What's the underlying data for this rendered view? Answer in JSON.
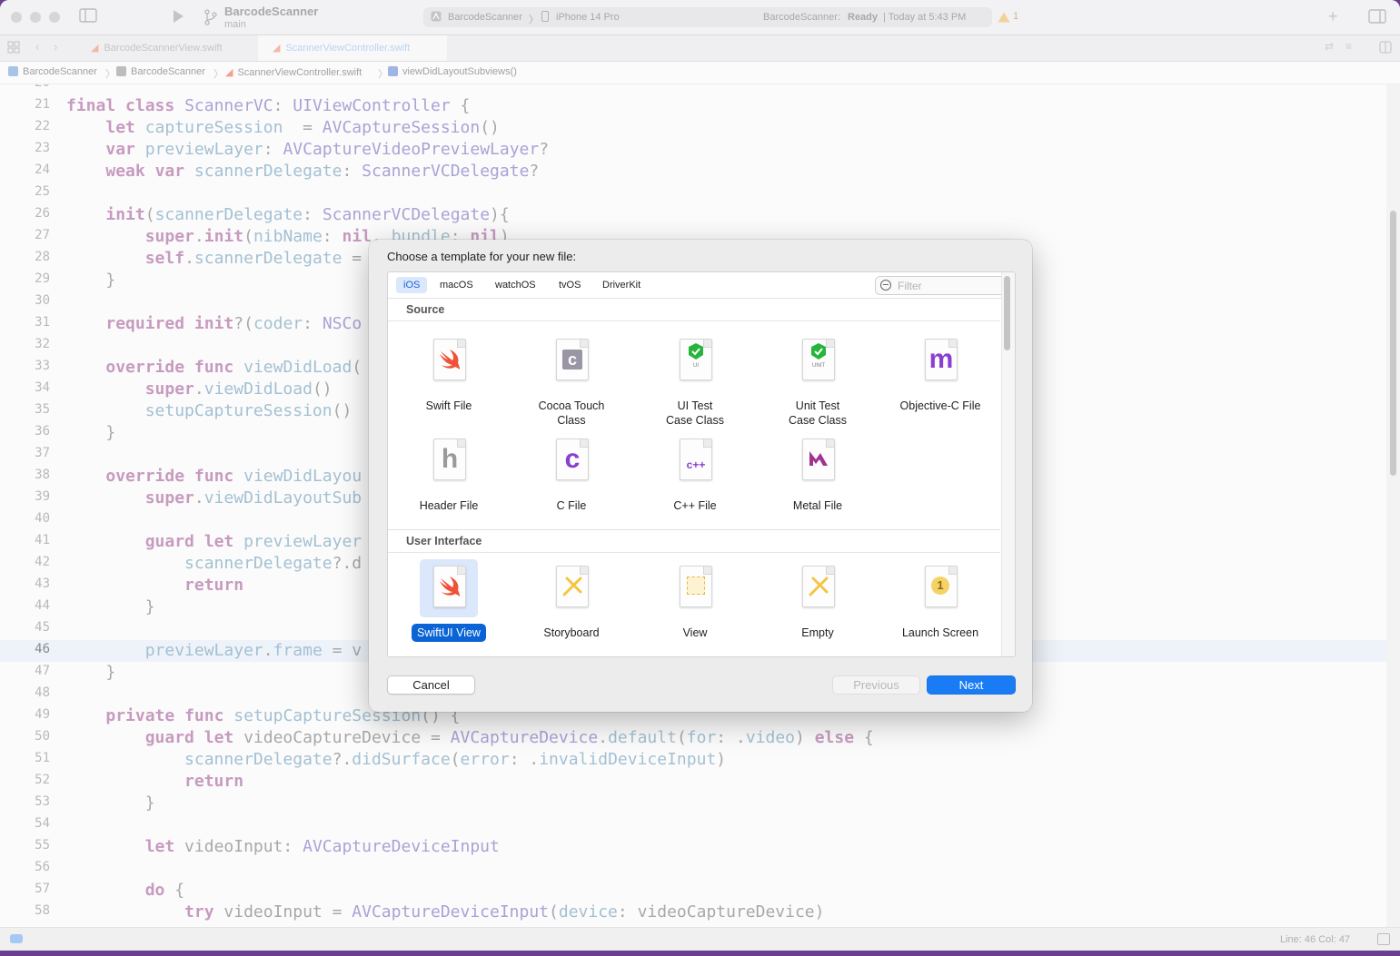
{
  "toolbar": {
    "project_name": "BarcodeScanner",
    "branch": "main",
    "scheme": "BarcodeScanner",
    "device": "iPhone 14 Pro",
    "status_project": "BarcodeScanner:",
    "status_state": "Ready",
    "status_time": "| Today at 5:43 PM",
    "warning_count": "1"
  },
  "tabs": [
    {
      "label": "BarcodeScannerView.swift"
    },
    {
      "label": "ScannerViewController.swift"
    }
  ],
  "breadcrumb": {
    "items": [
      "BarcodeScanner",
      "BarcodeScanner",
      "ScannerViewController.swift",
      "viewDidLayoutSubviews()"
    ]
  },
  "editor": {
    "current_line": "46",
    "lines": [
      {
        "n": "20",
        "t": ""
      },
      {
        "n": "21",
        "t": "final class ScannerVC: UIViewController {"
      },
      {
        "n": "22",
        "t": "    let captureSession  = AVCaptureSession()"
      },
      {
        "n": "23",
        "t": "    var previewLayer: AVCaptureVideoPreviewLayer?"
      },
      {
        "n": "24",
        "t": "    weak var scannerDelegate: ScannerVCDelegate?"
      },
      {
        "n": "25",
        "t": ""
      },
      {
        "n": "26",
        "t": "    init(scannerDelegate: ScannerVCDelegate){"
      },
      {
        "n": "27",
        "t": "        super.init(nibName: nil, bundle: nil)"
      },
      {
        "n": "28",
        "t": "        self.scannerDelegate ="
      },
      {
        "n": "29",
        "t": "    }"
      },
      {
        "n": "30",
        "t": ""
      },
      {
        "n": "31",
        "t": "    required init?(coder: NSCo"
      },
      {
        "n": "32",
        "t": ""
      },
      {
        "n": "33",
        "t": "    override func viewDidLoad("
      },
      {
        "n": "34",
        "t": "        super.viewDidLoad()"
      },
      {
        "n": "35",
        "t": "        setupCaptureSession()"
      },
      {
        "n": "36",
        "t": "    }"
      },
      {
        "n": "37",
        "t": ""
      },
      {
        "n": "38",
        "t": "    override func viewDidLayou"
      },
      {
        "n": "39",
        "t": "        super.viewDidLayoutSub"
      },
      {
        "n": "40",
        "t": ""
      },
      {
        "n": "41",
        "t": "        guard let previewLayer"
      },
      {
        "n": "42",
        "t": "            scannerDelegate?.d"
      },
      {
        "n": "43",
        "t": "            return"
      },
      {
        "n": "44",
        "t": "        }"
      },
      {
        "n": "45",
        "t": ""
      },
      {
        "n": "46",
        "t": "        previewLayer.frame = v"
      },
      {
        "n": "47",
        "t": "    }"
      },
      {
        "n": "48",
        "t": ""
      },
      {
        "n": "49",
        "t": "    private func setupCaptureSession() {"
      },
      {
        "n": "50",
        "t": "        guard let videoCaptureDevice = AVCaptureDevice.default(for: .video) else {"
      },
      {
        "n": "51",
        "t": "            scannerDelegate?.didSurface(error: .invalidDeviceInput)"
      },
      {
        "n": "52",
        "t": "            return"
      },
      {
        "n": "53",
        "t": "        }"
      },
      {
        "n": "54",
        "t": ""
      },
      {
        "n": "55",
        "t": "        let videoInput: AVCaptureDeviceInput"
      },
      {
        "n": "56",
        "t": ""
      },
      {
        "n": "57",
        "t": "        do {"
      },
      {
        "n": "58",
        "t": "            try videoInput = AVCaptureDeviceInput(device: videoCaptureDevice)"
      }
    ]
  },
  "statusbar": {
    "position": "Line: 46  Col: 47"
  },
  "dialog": {
    "title": "Choose a template for your new file:",
    "platforms": [
      "iOS",
      "macOS",
      "watchOS",
      "tvOS",
      "DriverKit"
    ],
    "selected_platform": "iOS",
    "filter_placeholder": "Filter",
    "filter_value": "",
    "sections": [
      {
        "title": "Source",
        "templates": [
          {
            "label": "Swift File",
            "icon": "swift-icon"
          },
          {
            "label": "Cocoa Touch\nClass",
            "icon": "cocoa-touch-class-icon"
          },
          {
            "label": "UI Test\nCase Class",
            "icon": "ui-test-icon"
          },
          {
            "label": "Unit Test\nCase Class",
            "icon": "unit-test-icon"
          },
          {
            "label": "Objective-C File",
            "icon": "objective-c-icon"
          },
          {
            "label": "Header File",
            "icon": "header-file-icon"
          },
          {
            "label": "C File",
            "icon": "c-file-icon"
          },
          {
            "label": "C++ File",
            "icon": "cpp-file-icon"
          },
          {
            "label": "Metal File",
            "icon": "metal-file-icon"
          }
        ]
      },
      {
        "title": "User Interface",
        "templates": [
          {
            "label": "SwiftUI View",
            "icon": "swift-icon"
          },
          {
            "label": "Storyboard",
            "icon": "storyboard-icon"
          },
          {
            "label": "View",
            "icon": "view-icon"
          },
          {
            "label": "Empty",
            "icon": "empty-icon"
          },
          {
            "label": "Launch Screen",
            "icon": "launch-screen-icon"
          }
        ]
      }
    ],
    "selected_template": "SwiftUI View",
    "buttons": {
      "cancel": "Cancel",
      "previous": "Previous",
      "next": "Next"
    }
  },
  "glyphs": {
    "c": "c",
    "h": "h",
    "m": "m",
    "cpp": "c++",
    "ui": "UI",
    "unit": "UNIT",
    "one": "1"
  },
  "colors": {
    "accent": "#1a7cf5",
    "selection": "#0a64d6",
    "swift": "#f05138",
    "objc_purple": "#8a3fd0",
    "test_green": "#28b43c",
    "ib_yellow": "#f5c542"
  }
}
